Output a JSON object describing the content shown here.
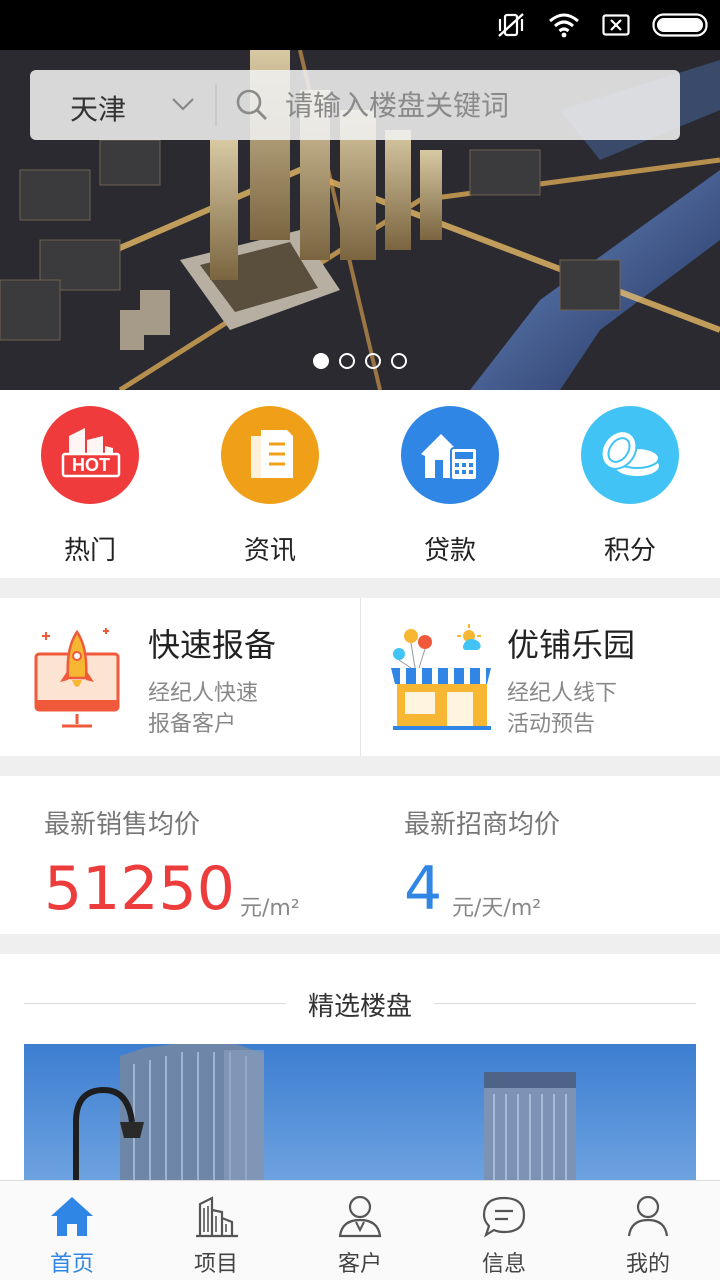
{
  "status_bar": {
    "icons": [
      "vibrate-off-icon",
      "wifi-icon",
      "sim-off-icon",
      "battery-icon"
    ]
  },
  "search": {
    "city": "天津",
    "placeholder": "请输入楼盘关键词"
  },
  "banner": {
    "slide_count": 4,
    "active_slide": 1
  },
  "quick_menu": [
    {
      "label": "热门",
      "icon": "hot-building-icon",
      "color": "#ef3b3b",
      "badge": "HOT"
    },
    {
      "label": "资讯",
      "icon": "news-document-icon",
      "color": "#f0a018"
    },
    {
      "label": "贷款",
      "icon": "loan-calculator-icon",
      "color": "#2f86e4"
    },
    {
      "label": "积分",
      "icon": "coins-icon",
      "color": "#41c4f5"
    }
  ],
  "feature_cards": [
    {
      "title": "快速报备",
      "desc_line1": "经纪人快速",
      "desc_line2": "报备客户",
      "icon": "rocket-monitor-icon"
    },
    {
      "title": "优铺乐园",
      "desc_line1": "经纪人线下",
      "desc_line2": "活动预告",
      "icon": "storefront-balloons-icon"
    }
  ],
  "prices": {
    "sale": {
      "label": "最新销售均价",
      "value": "51250",
      "unit": "元/m²",
      "color": "#ec3c3c"
    },
    "lease": {
      "label": "最新招商均价",
      "value": "4",
      "unit": "元/天/m²",
      "color": "#2f86e4"
    }
  },
  "featured": {
    "title": "精选楼盘"
  },
  "tabs": [
    {
      "label": "首页",
      "icon": "home-icon",
      "active": true
    },
    {
      "label": "项目",
      "icon": "buildings-icon",
      "active": false
    },
    {
      "label": "客户",
      "icon": "client-icon",
      "active": false
    },
    {
      "label": "信息",
      "icon": "message-icon",
      "active": false
    },
    {
      "label": "我的",
      "icon": "profile-icon",
      "active": false
    }
  ],
  "colors": {
    "accent": "#2f86e4",
    "price_red": "#ec3c3c"
  }
}
